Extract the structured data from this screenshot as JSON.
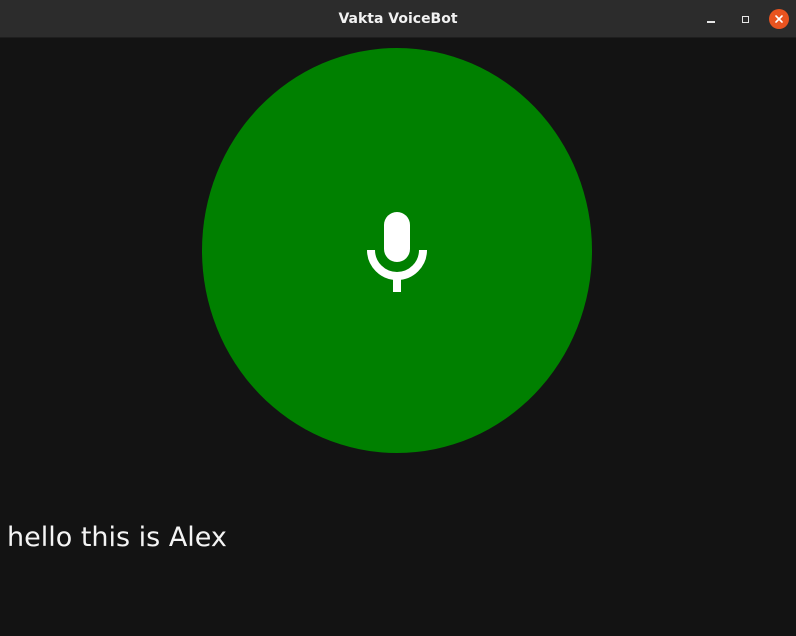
{
  "window": {
    "title": "Vakta VoiceBot",
    "controls": {
      "minimize": "minimize-icon",
      "maximize": "maximize-icon",
      "close": "close-icon"
    }
  },
  "mic": {
    "icon": "microphone-icon",
    "color": "#008000",
    "icon_color": "#ffffff"
  },
  "transcript": {
    "text": "hello this is Alex"
  },
  "colors": {
    "background": "#131313",
    "titlebar": "#2c2c2c",
    "close_button": "#e95420"
  }
}
